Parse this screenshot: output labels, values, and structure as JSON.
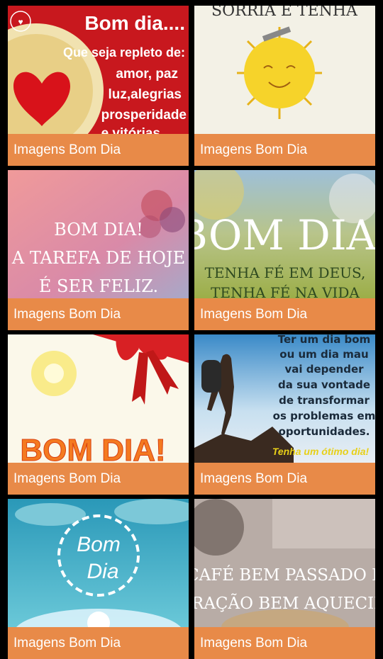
{
  "gallery": {
    "items": [
      {
        "caption": "Imagens Bom Dia",
        "lines": [
          "Bom dia....",
          "Que seja repleto de:",
          "amor, paz",
          "luz,alegrias",
          "prosperidade",
          "e vitórias"
        ]
      },
      {
        "caption": "Imagens Bom Dia",
        "lines": [
          "SORRIA E TENHA"
        ]
      },
      {
        "caption": "Imagens Bom Dia",
        "lines": [
          "BOM DIA!",
          "A TAREFA DE HOJE",
          "É SER FELIZ."
        ]
      },
      {
        "caption": "Imagens Bom Dia",
        "lines": [
          "BOM DIA!",
          "TENHA FÉ EM DEUS,",
          "TENHA FÉ NA VIDA"
        ]
      },
      {
        "caption": "Imagens Bom Dia",
        "lines": [
          "BOM DIA!"
        ]
      },
      {
        "caption": "Imagens Bom Dia",
        "lines": [
          "Ter um dia bom",
          "ou um dia mau",
          "vai depender",
          "da sua vontade",
          "de transformar",
          "os problemas em",
          "oportunidades.",
          "Tenha um ótimo dia!"
        ]
      },
      {
        "caption": "Imagens Bom Dia",
        "lines": [
          "Bom",
          "Dia"
        ]
      },
      {
        "caption": "Imagens Bom Dia",
        "lines": [
          "UM CAFÉ BEM PASSADO E UM",
          "CORAÇÃO BEM AQUECIDO."
        ]
      }
    ]
  },
  "colors": {
    "caption_bg": "#e88a48",
    "caption_text": "#ffffff",
    "background": "#000000"
  }
}
